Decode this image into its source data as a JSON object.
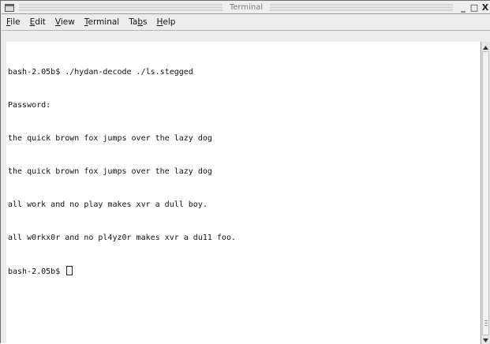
{
  "window": {
    "title": "Terminal",
    "controls": {
      "minimize": "_",
      "maximize": "□",
      "close": "X"
    }
  },
  "menubar": {
    "items": [
      {
        "mnemonic": "F",
        "rest": "ile"
      },
      {
        "mnemonic": "E",
        "rest": "dit"
      },
      {
        "mnemonic": "V",
        "rest": "iew"
      },
      {
        "mnemonic": "T",
        "rest": "erminal"
      },
      {
        "prefix": "Ta",
        "mnemonic": "b",
        "rest": "s"
      },
      {
        "mnemonic": "H",
        "rest": "elp"
      }
    ]
  },
  "terminal": {
    "lines": [
      "bash-2.05b$ ./hydan-decode ./ls.stegged",
      "Password:",
      "the quick brown fox jumps over the lazy dog",
      "the quick brown fox jumps over the lazy dog",
      "all work and no play makes xvr a dull boy.",
      "all w0rkx0r and no pl4yz0r makes xvr a du11 foo."
    ],
    "prompt": "bash-2.05b$"
  },
  "icons": {
    "window_menu": "window-menu-icon",
    "scroll_up": "scroll-up-arrow-icon",
    "scroll_down": "scroll-down-arrow-icon"
  }
}
